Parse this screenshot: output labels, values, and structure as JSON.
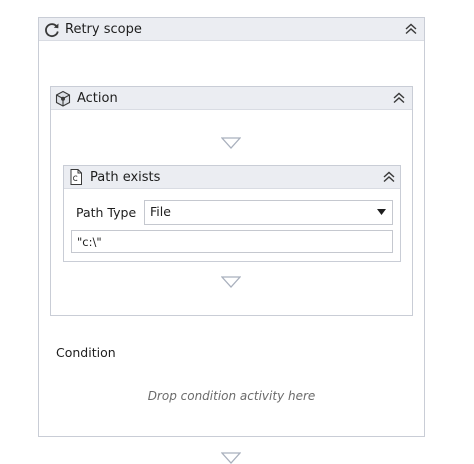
{
  "retry_scope": {
    "title": "Retry scope",
    "icon": "refresh-icon"
  },
  "action": {
    "title": "Action",
    "icon": "activity-cube-icon"
  },
  "path_exists": {
    "title": "Path exists",
    "icon": "document-icon",
    "path_type_label": "Path Type",
    "path_type_value": "File",
    "path_value": "\"c:\\\""
  },
  "condition": {
    "label": "Condition",
    "drop_hint": "Drop condition activity here"
  },
  "colors": {
    "header_bg": "#ebedf2",
    "border": "#c9cdd6",
    "arrow": "#a9b0bd"
  }
}
